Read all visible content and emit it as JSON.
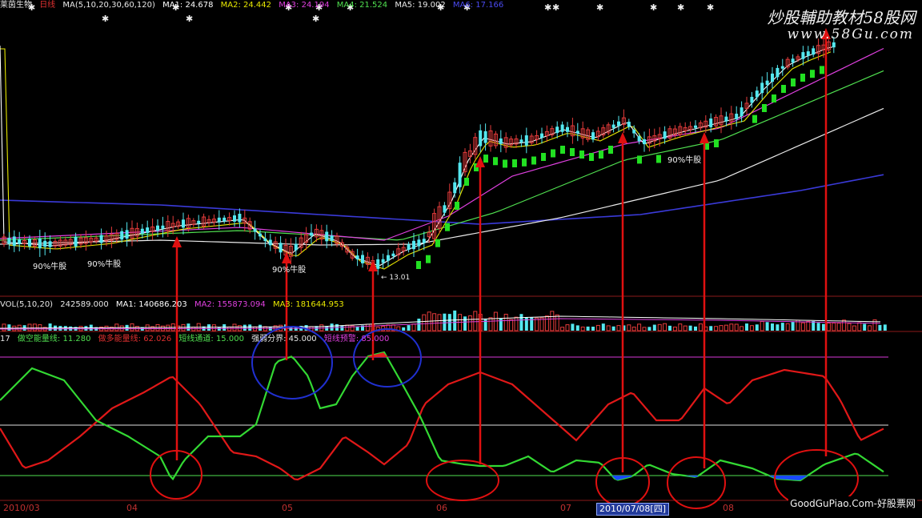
{
  "price_header": {
    "stock_name": "莱茵生物",
    "period": "日线",
    "ma_params": "MA(5,10,20,30,60,120)",
    "ma1": "MA1: 24.678",
    "ma2": "MA2: 24.442",
    "ma3": "MA3: 24.194",
    "ma4": "MA4: 21.524",
    "ma5": "MA5: 19.002",
    "ma6": "MA6: 17.166"
  },
  "vol_header": {
    "label": "VOL(5,10,20)",
    "value": "242589.000",
    "ma1": "MA1: 140686.203",
    "ma2": "MA2: 155873.094",
    "ma3": "MA3: 181644.953"
  },
  "indicator_header": {
    "index": "17",
    "short_energy": "做空能量线: 11.280",
    "long_energy": "做多能量线: 62.026",
    "short_channel": "短线通道: 15.000",
    "strength_label": "强弱分界: 45.000",
    "short_alert": "短线预警: 85.000"
  },
  "annotations": {
    "bull_label_1": "90%牛股",
    "bull_label_2": "90%牛股",
    "bull_label_3": "90%牛股",
    "bull_label_4": "90%牛股",
    "low_price": "13.01"
  },
  "dates": {
    "d1": "2010/03",
    "d2": "04",
    "d3": "05",
    "d4": "06",
    "d5": "07",
    "d6": "08",
    "highlight": "2010/07/08[四]"
  },
  "watermark": {
    "top_cn": "炒股輔助教材58股网",
    "top_url": "www.58Gu.com",
    "bottom": "GoodGuPiao.Com-好股票网"
  },
  "colors": {
    "background": "#000000",
    "rise_red": "#e53b3b",
    "fall_cyan": "#54e8f0",
    "ma_white": "#ffffff",
    "ma_yellow": "#e8e800",
    "ma_magenta": "#e040e0",
    "ma_green": "#50e050",
    "ma_blue": "#3a3ad8",
    "short_energy_green": "#33d933",
    "long_energy_red": "#e01818",
    "markup_red": "#e01010",
    "markup_blue": "#2030d0",
    "fill_blue": "#1a4aff"
  }
}
